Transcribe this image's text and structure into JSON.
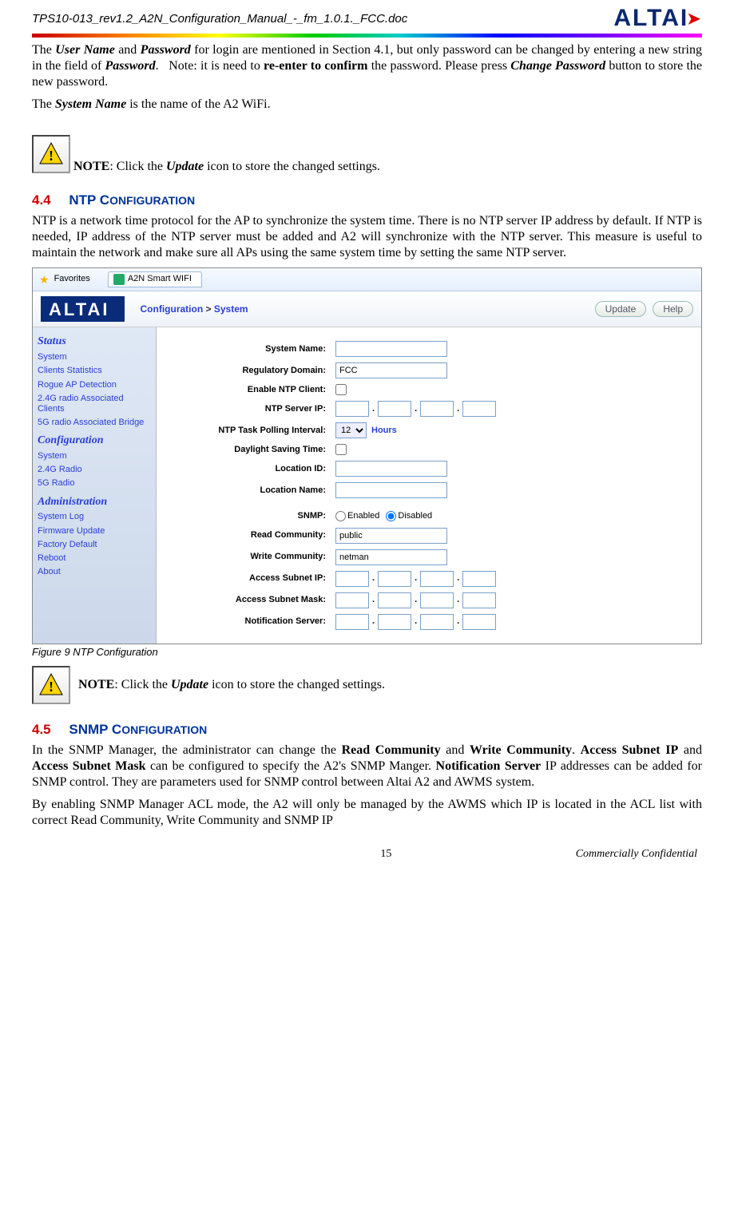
{
  "doc_id": "TPS10-013_rev1.2_A2N_Configuration_Manual_-_fm_1.0.1._FCC.doc",
  "brand": "ALTAI",
  "para_intro": "The User Name and Password for login are mentioned in Section 4.1, but only password can be changed by entering a new string in the field of Password.   Note: it is need to re-enter to confirm the password. Please press Change Password button to store the new password.",
  "para_sysname": "The System Name is the name of the A2 WiFi.",
  "note_label": "NOTE",
  "note_text": ": Click the Update icon to store the changed settings.",
  "sec44_num": "4.4",
  "sec44_title": "NTP Configuration",
  "sec44_para": "NTP is a network time protocol for the AP to synchronize the system time. There is no NTP server IP address by default. If NTP is needed, IP address of the NTP server must be added and A2 will synchronize with the NTP server. This measure is useful to maintain the network and make sure all APs using the same system time by setting the same NTP server.",
  "fig9_caption": "Figure 9     NTP Configuration",
  "sec45_num": "4.5",
  "sec45_title": "SNMP Configuration",
  "sec45_para1": "In the SNMP Manager, the administrator can change the Read Community and Write Community. Access Subnet IP and Access Subnet Mask can be configured to specify the A2's SNMP Manger. Notification Server IP addresses can be added for SNMP control. They are parameters used for SNMP control between Altai A2 and AWMS system.",
  "sec45_para2": "By enabling SNMP Manager ACL mode, the A2 will only be managed by the AWMS which IP is located in the ACL list with correct Read Community, Write Community and SNMP IP",
  "page_number": "15",
  "footer_conf": "Commercially Confidential",
  "screenshot": {
    "fav_label": "Favorites",
    "tab_label": "A2N Smart WIFI",
    "breadcrumb_a": "Configuration",
    "breadcrumb_sep": ">",
    "breadcrumb_b": "System",
    "btn_update": "Update",
    "btn_help": "Help",
    "sidebar": {
      "status_title": "Status",
      "status_items": [
        "System",
        "Clients Statistics",
        "Rogue AP Detection",
        "2.4G radio Associated Clients",
        "5G radio Associated Bridge"
      ],
      "config_title": "Configuration",
      "config_items": [
        "System",
        "2.4G Radio",
        "5G Radio"
      ],
      "admin_title": "Administration",
      "admin_items": [
        "System Log",
        "Firmware Update",
        "Factory Default",
        "Reboot",
        "About"
      ]
    },
    "form": {
      "system_name": "System Name:",
      "reg_domain_lbl": "Regulatory Domain:",
      "reg_domain_val": "FCC",
      "enable_ntp": "Enable NTP Client:",
      "ntp_server_ip": "NTP Server IP:",
      "ntp_poll_lbl": "NTP Task Polling Interval:",
      "ntp_poll_val": "12",
      "ntp_poll_unit": "Hours",
      "dst": "Daylight Saving Time:",
      "loc_id": "Location ID:",
      "loc_name": "Location Name:",
      "snmp_lbl": "SNMP:",
      "snmp_enabled": "Enabled",
      "snmp_disabled": "Disabled",
      "read_comm_lbl": "Read Community:",
      "read_comm_val": "public",
      "write_comm_lbl": "Write Community:",
      "write_comm_val": "netman",
      "access_ip": "Access Subnet IP:",
      "access_mask": "Access Subnet Mask:",
      "notif_server": "Notification Server:"
    }
  }
}
